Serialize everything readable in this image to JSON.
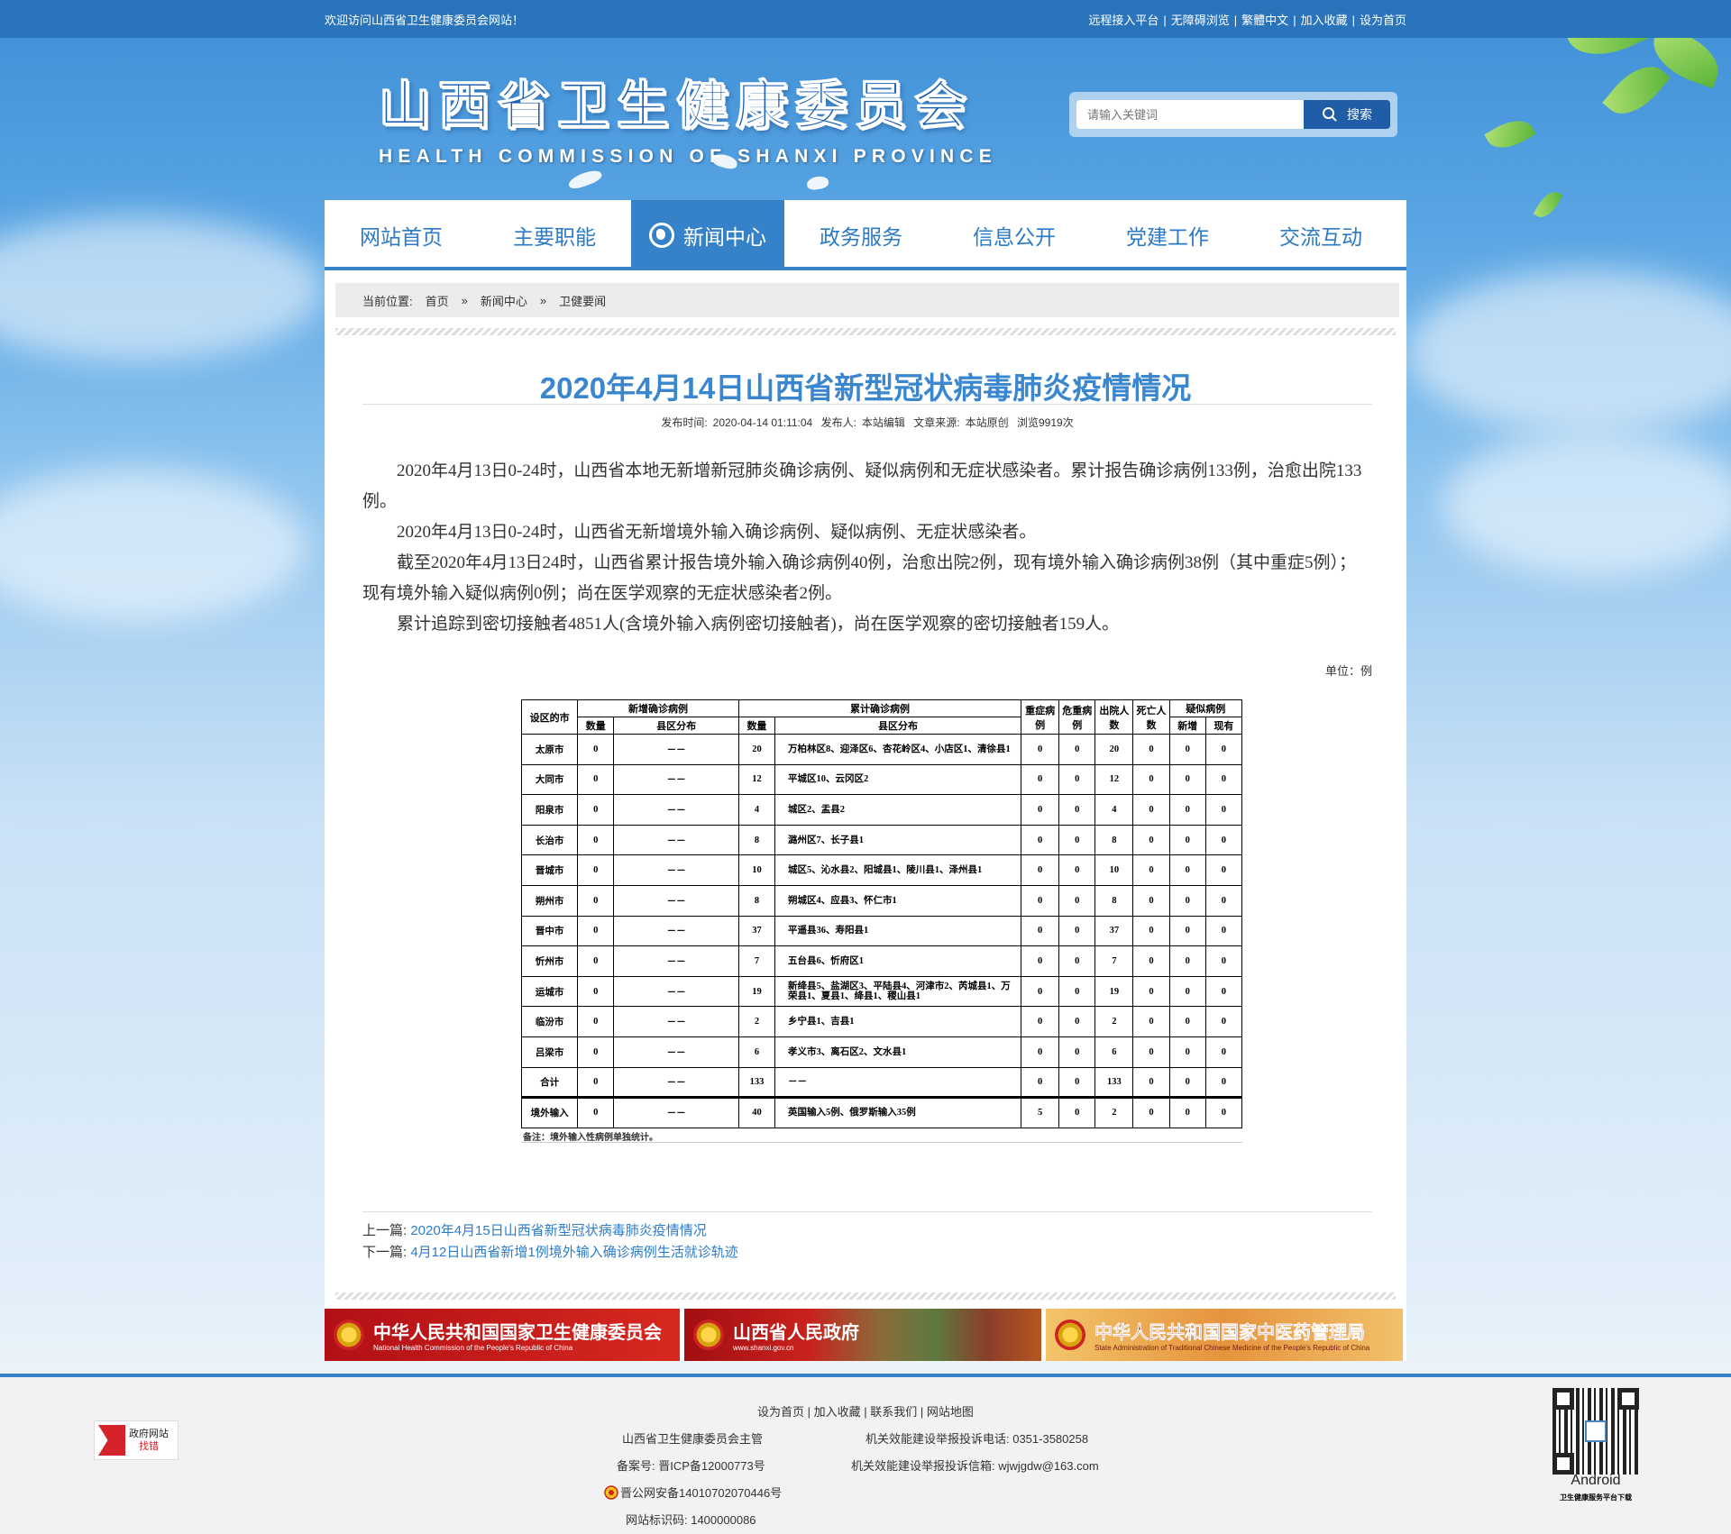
{
  "topbar": {
    "welcome": "欢迎访问山西省卫生健康委员会网站！",
    "links": [
      "远程接入平台",
      "无障碍浏览",
      "繁體中文",
      "加入收藏",
      "设为首页"
    ]
  },
  "header": {
    "logo_cn": "山西省卫生健康委员会",
    "logo_en": "HEALTH COMMISSION OF SHANXI PROVINCE",
    "search_placeholder": "请输入关键词",
    "search_button": "搜索"
  },
  "nav": {
    "items": [
      "网站首页",
      "主要职能",
      "新闻中心",
      "政务服务",
      "信息公开",
      "党建工作",
      "交流互动"
    ],
    "active": "新闻中心"
  },
  "breadcrumb": {
    "label": "当前位置:",
    "items": [
      "首页",
      "新闻中心",
      "卫健要闻"
    ],
    "separator": "»"
  },
  "article": {
    "title": "2020年4月14日山西省新型冠状病毒肺炎疫情情况",
    "meta": {
      "publish_label": "发布时间:",
      "publish_time": "2020-04-14 01:11:04",
      "author_label": "发布人:",
      "author": "本站编辑",
      "source_label": "文章来源:",
      "source": "本站原创",
      "views": "浏览9919次"
    },
    "paragraphs": [
      "2020年4月13日0-24时，山西省本地无新增新冠肺炎确诊病例、疑似病例和无症状感染者。累计报告确诊病例133例，治愈出院133例。",
      "2020年4月13日0-24时，山西省无新增境外输入确诊病例、疑似病例、无症状感染者。",
      "截至2020年4月13日24时，山西省累计报告境外输入确诊病例40例，治愈出院2例，现有境外输入确诊病例38例（其中重症5例）；现有境外输入疑似病例0例；尚在医学观察的无症状感染者2例。",
      "累计追踪到密切接触者4851人(含境外输入病例密切接触者)，尚在医学观察的密切接触者159人。"
    ],
    "unit": "单位：例"
  },
  "table": {
    "headers": {
      "city": "设区的市",
      "new_confirmed": "新增确诊病例",
      "cumulative": "累计确诊病例",
      "severe": "重症病例",
      "critical": "危重病例",
      "discharged": "出院人数",
      "deaths": "死亡人数",
      "suspected": "疑似病例",
      "count": "数量",
      "district": "县区分布",
      "new": "新增",
      "current": "现有"
    },
    "rows": [
      [
        "太原市",
        "0",
        "－－",
        "20",
        "万柏林区8、迎泽区6、杏花岭区4、小店区1、清徐县1",
        "0",
        "0",
        "20",
        "0",
        "0",
        "0"
      ],
      [
        "大同市",
        "0",
        "－－",
        "12",
        "平城区10、云冈区2",
        "0",
        "0",
        "12",
        "0",
        "0",
        "0"
      ],
      [
        "阳泉市",
        "0",
        "－－",
        "4",
        "城区2、盂县2",
        "0",
        "0",
        "4",
        "0",
        "0",
        "0"
      ],
      [
        "长治市",
        "0",
        "－－",
        "8",
        "潞州区7、长子县1",
        "0",
        "0",
        "8",
        "0",
        "0",
        "0"
      ],
      [
        "晋城市",
        "0",
        "－－",
        "10",
        "城区5、沁水县2、阳城县1、陵川县1、泽州县1",
        "0",
        "0",
        "10",
        "0",
        "0",
        "0"
      ],
      [
        "朔州市",
        "0",
        "－－",
        "8",
        "朔城区4、应县3、怀仁市1",
        "0",
        "0",
        "8",
        "0",
        "0",
        "0"
      ],
      [
        "晋中市",
        "0",
        "－－",
        "37",
        "平遥县36、寿阳县1",
        "0",
        "0",
        "37",
        "0",
        "0",
        "0"
      ],
      [
        "忻州市",
        "0",
        "－－",
        "7",
        "五台县6、忻府区1",
        "0",
        "0",
        "7",
        "0",
        "0",
        "0"
      ],
      [
        "运城市",
        "0",
        "－－",
        "19",
        "新绛县5、盐湖区3、平陆县4、河津市2、芮城县1、万荣县1、夏县1、绛县1、稷山县1",
        "0",
        "0",
        "19",
        "0",
        "0",
        "0"
      ],
      [
        "临汾市",
        "0",
        "－－",
        "2",
        "乡宁县1、吉县1",
        "0",
        "0",
        "2",
        "0",
        "0",
        "0"
      ],
      [
        "吕梁市",
        "0",
        "－－",
        "6",
        "孝义市3、离石区2、文水县1",
        "0",
        "0",
        "6",
        "0",
        "0",
        "0"
      ],
      [
        "合计",
        "0",
        "－－",
        "133",
        "－－",
        "0",
        "0",
        "133",
        "0",
        "0",
        "0"
      ],
      [
        "境外输入",
        "0",
        "－－",
        "40",
        "英国输入5例、俄罗斯输入35例",
        "5",
        "0",
        "2",
        "0",
        "0",
        "0"
      ]
    ],
    "note": "备注：境外输入性病例单独统计。"
  },
  "prev_next": {
    "prev_label": "上一篇:",
    "prev_title": "2020年4月15日山西省新型冠状病毒肺炎疫情情况",
    "next_label": "下一篇:",
    "next_title": "4月12日山西省新增1例境外输入确诊病例生活就诊轨迹"
  },
  "banners": [
    {
      "cn": "中华人民共和国国家卫生健康委员会",
      "en": "National Health Commission of the People's Republic of China"
    },
    {
      "cn": "山西省人民政府",
      "en": "www.shanxi.gov.cn"
    },
    {
      "cn": "中华人民共和国国家中医药管理局",
      "en": "State Administration of Traditional Chinese Medicine of the People's Republic of China"
    }
  ],
  "footer": {
    "links": [
      "设为首页",
      "加入收藏",
      "联系我们",
      "网站地图"
    ],
    "sponsor": "山西省卫生健康委员会主管",
    "complaint_phone": "机关效能建设举报投诉电话:  0351-3580258",
    "icp": "备案号:  晋ICP备12000773号",
    "complaint_email": "机关效能建设举报投诉信箱:  wjwjgdw@163.com",
    "police": "晋公网安备14010702070446号",
    "site_id": "网站标识码:  1400000086",
    "gov_badge_top": "政府网站",
    "gov_badge_bottom": "找错",
    "app_label": "Android",
    "app_sub": "卫生健康服务平台下载"
  },
  "colors": {
    "primary": "#3582c8",
    "title": "#3b87cf",
    "link": "#2b7ccb",
    "topbar": "#2a74bb"
  }
}
